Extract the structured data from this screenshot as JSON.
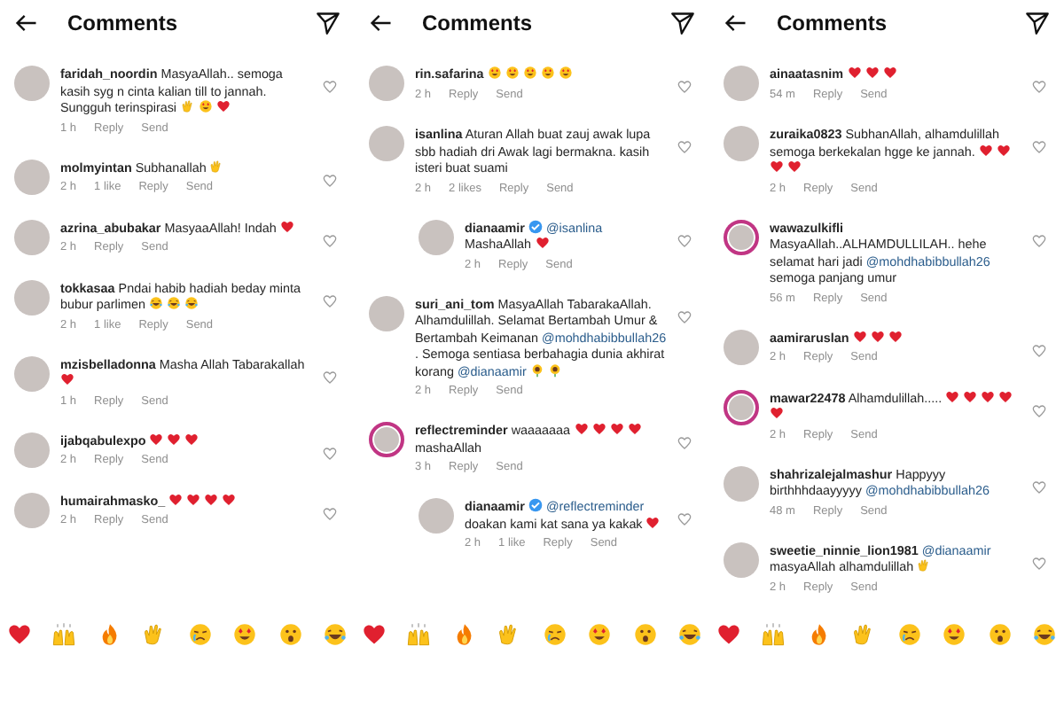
{
  "panels": [
    {
      "title": "Comments",
      "comments": [
        {
          "username": "faridah_noordin",
          "verified": false,
          "ring": false,
          "reply": false,
          "body": [
            {
              "kind": "text",
              "text": "MasyaAllah.. semoga kasih syg n cinta kalian till to jannah. Sungguh terinspirasi"
            },
            {
              "kind": "clap"
            },
            {
              "kind": "heart-eyes"
            },
            {
              "kind": "heart"
            }
          ],
          "time": "1 h",
          "actions": [
            "Reply",
            "Send"
          ]
        },
        {
          "username": "molmyintan",
          "verified": false,
          "ring": false,
          "reply": false,
          "body": [
            {
              "kind": "text",
              "text": "Subhanallah"
            },
            {
              "kind": "clap"
            }
          ],
          "time": "2 h",
          "likes": "1 like",
          "actions": [
            "Reply",
            "Send"
          ]
        },
        {
          "username": "azrina_abubakar",
          "verified": false,
          "ring": false,
          "reply": false,
          "body": [
            {
              "kind": "text",
              "text": "MasyaaAllah! Indah"
            },
            {
              "kind": "heart"
            }
          ],
          "time": "2 h",
          "actions": [
            "Reply",
            "Send"
          ]
        },
        {
          "username": "tokkasaa",
          "verified": false,
          "ring": false,
          "reply": false,
          "body": [
            {
              "kind": "text",
              "text": "Pndai habib hadiah beday minta bubur parlimen"
            },
            {
              "kind": "laugh"
            },
            {
              "kind": "laugh"
            },
            {
              "kind": "laugh"
            }
          ],
          "time": "2 h",
          "likes": "1 like",
          "actions": [
            "Reply",
            "Send"
          ]
        },
        {
          "username": "mzisbelladonna",
          "verified": false,
          "ring": false,
          "reply": false,
          "body": [
            {
              "kind": "text",
              "text": "Masha Allah Tabarakallah"
            },
            {
              "kind": "heart"
            }
          ],
          "time": "1 h",
          "actions": [
            "Reply",
            "Send"
          ]
        },
        {
          "username": "ijabqabulexpo",
          "verified": false,
          "ring": false,
          "reply": false,
          "body": [
            {
              "kind": "heart"
            },
            {
              "kind": "heart"
            },
            {
              "kind": "heart"
            }
          ],
          "time": "2 h",
          "actions": [
            "Reply",
            "Send"
          ]
        },
        {
          "username": "humairahmasko_",
          "verified": false,
          "ring": false,
          "reply": false,
          "body": [
            {
              "kind": "heart"
            },
            {
              "kind": "heart"
            },
            {
              "kind": "heart"
            },
            {
              "kind": "heart"
            }
          ],
          "time": "2 h",
          "actions": [
            "Reply",
            "Send"
          ]
        }
      ],
      "emoji_bar": [
        {
          "kind": "heart"
        },
        {
          "kind": "raised-hands"
        },
        {
          "kind": "fire"
        },
        {
          "kind": "clap"
        },
        {
          "kind": "cry"
        },
        {
          "kind": "heart-eyes"
        },
        {
          "kind": "surprised"
        },
        {
          "kind": "laugh"
        }
      ]
    },
    {
      "title": "Comments",
      "comments": [
        {
          "username": "rin.safarina",
          "verified": false,
          "ring": false,
          "reply": false,
          "body": [
            {
              "kind": "heart-eyes"
            },
            {
              "kind": "heart-eyes"
            },
            {
              "kind": "heart-eyes"
            },
            {
              "kind": "heart-eyes"
            },
            {
              "kind": "heart-eyes"
            }
          ],
          "time": "2 h",
          "actions": [
            "Reply",
            "Send"
          ]
        },
        {
          "username": "isanlina",
          "verified": false,
          "ring": false,
          "reply": false,
          "body": [
            {
              "kind": "text",
              "text": "Aturan Allah buat zauj awak lupa sbb hadiah dri Awak lagi bermakna. kasih isteri buat suami"
            }
          ],
          "time": "2 h",
          "likes": "2 likes",
          "actions": [
            "Reply",
            "Send"
          ]
        },
        {
          "username": "dianaamir",
          "verified": true,
          "ring": false,
          "reply": true,
          "body": [
            {
              "kind": "mention",
              "text": "@isanlina"
            },
            {
              "kind": "text",
              "text": "MashaAllah"
            },
            {
              "kind": "heart"
            }
          ],
          "time": "2 h",
          "actions": [
            "Reply",
            "Send"
          ]
        },
        {
          "username": "suri_ani_tom",
          "verified": false,
          "ring": false,
          "reply": false,
          "body": [
            {
              "kind": "text",
              "text": "MasyaAllah TabarakaAllah. Alhamdulillah. Selamat Bertambah Umur & Bertambah Keimanan"
            },
            {
              "kind": "mention",
              "text": "@mohdhabibbullah26"
            },
            {
              "kind": "text",
              "text": ". Semoga sentiasa berbahagia dunia akhirat korang"
            },
            {
              "kind": "mention",
              "text": "@dianaamir"
            },
            {
              "kind": "sunflower"
            },
            {
              "kind": "sunflower"
            }
          ],
          "time": "2 h",
          "actions": [
            "Reply",
            "Send"
          ]
        },
        {
          "username": "reflectreminder",
          "verified": false,
          "ring": true,
          "reply": false,
          "body": [
            {
              "kind": "text",
              "text": "waaaaaaa"
            },
            {
              "kind": "heart"
            },
            {
              "kind": "heart"
            },
            {
              "kind": "heart"
            },
            {
              "kind": "heart"
            },
            {
              "kind": "text",
              "text": "mashaAllah"
            }
          ],
          "time": "3 h",
          "actions": [
            "Reply",
            "Send"
          ]
        },
        {
          "username": "dianaamir",
          "verified": true,
          "ring": false,
          "reply": true,
          "body": [
            {
              "kind": "mention",
              "text": "@reflectreminder"
            },
            {
              "kind": "text",
              "text": "doakan kami kat sana ya kakak"
            },
            {
              "kind": "heart"
            }
          ],
          "time": "2 h",
          "likes": "1 like",
          "actions": [
            "Reply",
            "Send"
          ]
        }
      ],
      "emoji_bar": [
        {
          "kind": "heart"
        },
        {
          "kind": "raised-hands"
        },
        {
          "kind": "fire"
        },
        {
          "kind": "clap"
        },
        {
          "kind": "cry"
        },
        {
          "kind": "heart-eyes"
        },
        {
          "kind": "surprised"
        },
        {
          "kind": "laugh"
        }
      ]
    },
    {
      "title": "Comments",
      "comments": [
        {
          "username": "ainaatasnim",
          "verified": false,
          "ring": false,
          "reply": false,
          "body": [
            {
              "kind": "heart"
            },
            {
              "kind": "heart"
            },
            {
              "kind": "heart"
            }
          ],
          "time": "54 m",
          "actions": [
            "Reply",
            "Send"
          ]
        },
        {
          "username": "zuraika0823",
          "verified": false,
          "ring": false,
          "reply": false,
          "body": [
            {
              "kind": "text",
              "text": "SubhanAllah, alhamdulillah semoga berkekalan hgge ke jannah."
            },
            {
              "kind": "heart"
            },
            {
              "kind": "heart"
            },
            {
              "kind": "heart"
            },
            {
              "kind": "heart"
            }
          ],
          "time": "2 h",
          "actions": [
            "Reply",
            "Send"
          ]
        },
        {
          "username": "wawazulkifli",
          "verified": false,
          "ring": true,
          "reply": false,
          "body": [
            {
              "kind": "text",
              "text": "MasyaAllah..ALHAMDULLILAH.. hehe selamat hari jadi"
            },
            {
              "kind": "mention",
              "text": "@mohdhabibbullah26"
            },
            {
              "kind": "text",
              "text": "semoga panjang umur"
            }
          ],
          "time": "56 m",
          "actions": [
            "Reply",
            "Send"
          ]
        },
        {
          "username": "aamiraruslan",
          "verified": false,
          "ring": false,
          "reply": false,
          "body": [
            {
              "kind": "heart"
            },
            {
              "kind": "heart"
            },
            {
              "kind": "heart"
            }
          ],
          "time": "2 h",
          "actions": [
            "Reply",
            "Send"
          ]
        },
        {
          "username": "mawar22478",
          "verified": false,
          "ring": true,
          "reply": false,
          "body": [
            {
              "kind": "text",
              "text": "Alhamdulillah....."
            },
            {
              "kind": "heart"
            },
            {
              "kind": "heart"
            },
            {
              "kind": "heart"
            },
            {
              "kind": "heart"
            },
            {
              "kind": "heart"
            }
          ],
          "time": "2 h",
          "actions": [
            "Reply",
            "Send"
          ]
        },
        {
          "username": "shahrizalejalmashur",
          "verified": false,
          "ring": false,
          "reply": false,
          "body": [
            {
              "kind": "text",
              "text": "Happyyy birthhhdaayyyyy"
            },
            {
              "kind": "mention",
              "text": "@mohdhabibbullah26"
            }
          ],
          "time": "48 m",
          "actions": [
            "Reply",
            "Send"
          ]
        },
        {
          "username": "sweetie_ninnie_lion1981",
          "verified": false,
          "ring": false,
          "reply": false,
          "body": [
            {
              "kind": "mention",
              "text": "@dianaamir"
            },
            {
              "kind": "text",
              "text": "masyaAllah alhamdulillah"
            },
            {
              "kind": "clap"
            }
          ],
          "time": "2 h",
          "actions": [
            "Reply",
            "Send"
          ]
        }
      ],
      "emoji_bar": [
        {
          "kind": "heart"
        },
        {
          "kind": "raised-hands"
        },
        {
          "kind": "fire"
        },
        {
          "kind": "clap"
        },
        {
          "kind": "cry"
        },
        {
          "kind": "heart-eyes"
        },
        {
          "kind": "surprised"
        },
        {
          "kind": "laugh"
        }
      ]
    }
  ]
}
